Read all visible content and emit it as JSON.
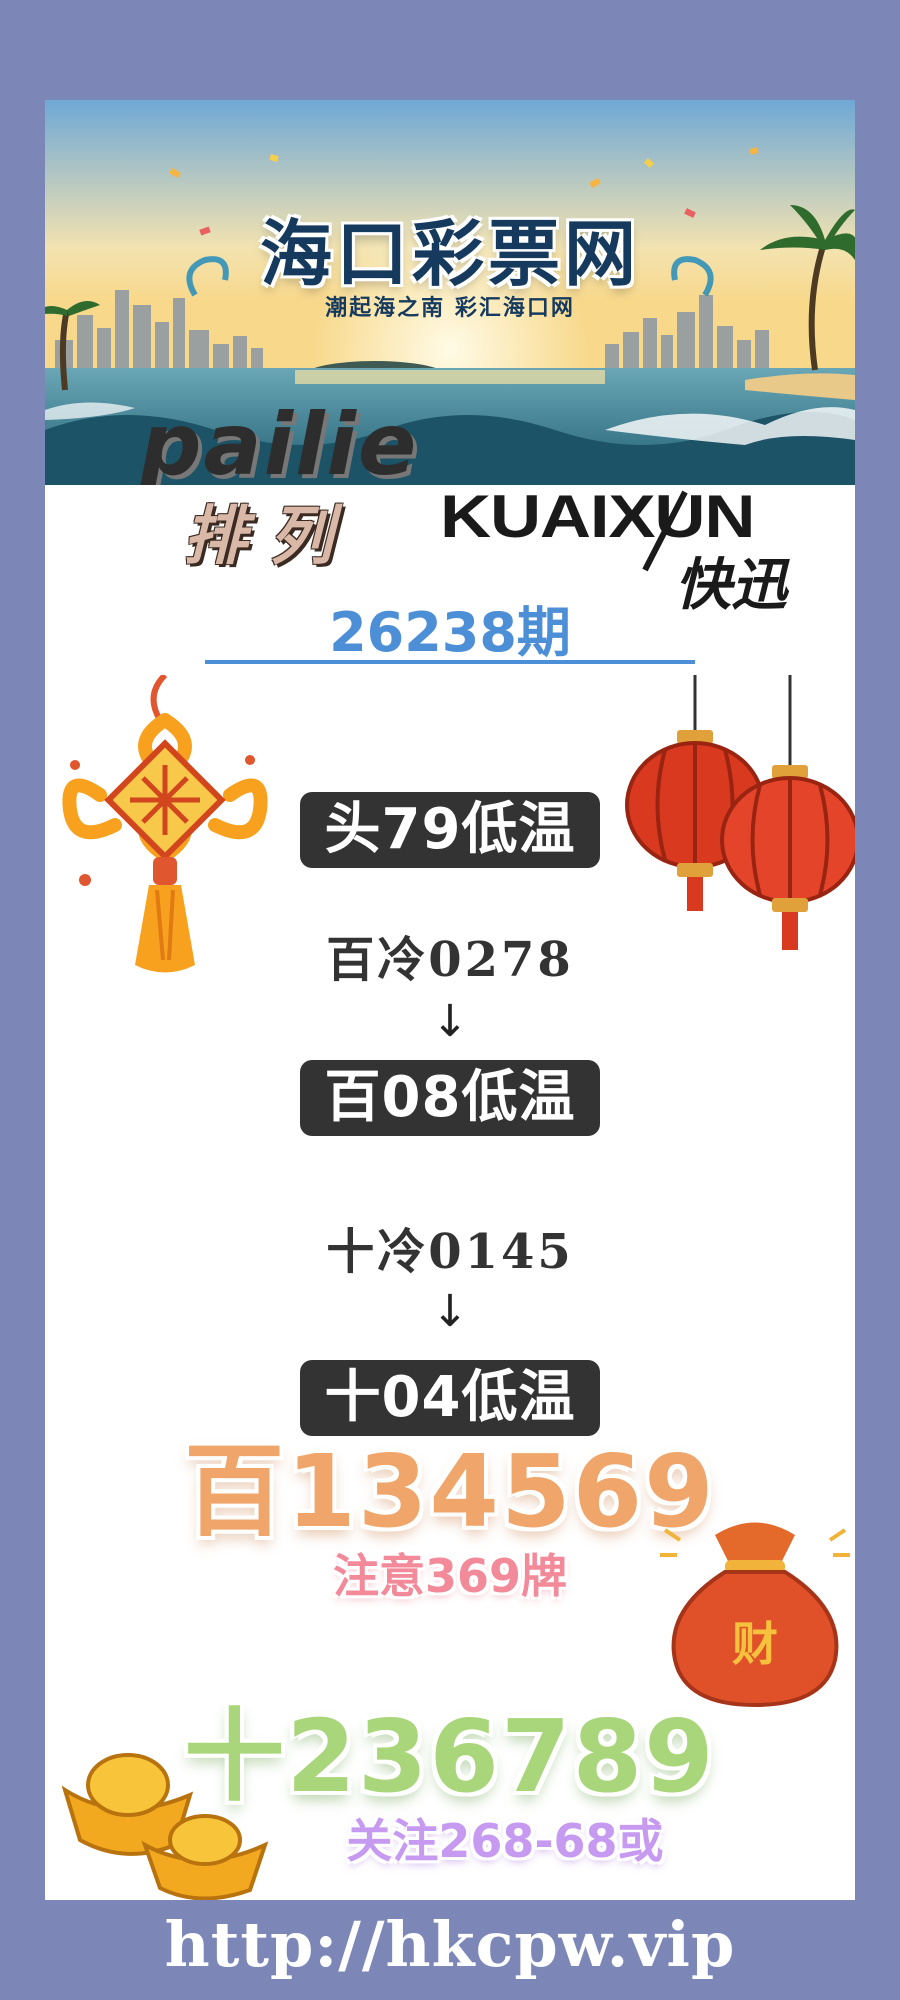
{
  "banner": {
    "title": "海口彩票网",
    "slogan": "潮起海之南  彩汇海口网",
    "pailie_latin": "pailie"
  },
  "brand": {
    "pailie_cn": "排列",
    "kuaixun_latin": "KUAIXUN",
    "kuaixun_cn": "快迅"
  },
  "issue": {
    "label": "26238期"
  },
  "predictions": {
    "head_pill": "头79低温",
    "hundreds_cold": "百冷0278",
    "hundreds_pill": "百08低温",
    "tens_cold": "十冷0145",
    "tens_pill": "十04低温",
    "arrow": "↓"
  },
  "picks": {
    "hundreds_big": "百134569",
    "hundreds_note": "注意369牌",
    "tens_big": "十236789",
    "tens_note": "关注268-68或"
  },
  "footer": {
    "url": "http://hkcpw.vip"
  },
  "icons": [
    "chinese-knot-icon",
    "red-lanterns-icon",
    "money-bag-icon",
    "gold-ingots-icon"
  ],
  "colors": {
    "frame": "#7c87b8",
    "issue_blue": "#4d8fd6",
    "pill": "#333333",
    "hundreds_orange": "#f0a66a",
    "hundreds_note_pink": "#f38a9a",
    "tens_green": "#a9d67a",
    "tens_note_purple": "#c69af0"
  }
}
